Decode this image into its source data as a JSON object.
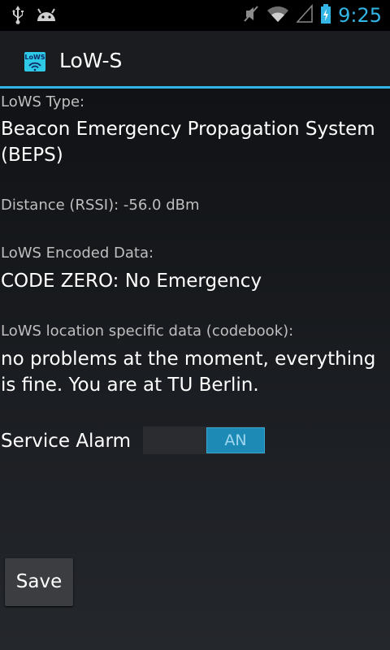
{
  "status_bar": {
    "time": "9:25",
    "icons": [
      "usb-icon",
      "android-debug-icon",
      "mute-icon",
      "wifi-icon",
      "signal-icon",
      "battery-charging-icon"
    ]
  },
  "action_bar": {
    "app_icon_text": "LoWS",
    "title": "LoW-S"
  },
  "fields": {
    "type_label": "LoWS Type:",
    "type_value": "Beacon Emergency Propagation System (BEPS)",
    "distance": "Distance (RSSI): -56.0 dBm",
    "encoded_label": "LoWS Encoded Data:",
    "encoded_value": "CODE ZERO: No Emergency",
    "location_label": "LoWS location specific data (codebook):",
    "location_value": "no problems at the moment, everything is fine. You are at TU Berlin."
  },
  "service_alarm": {
    "label": "Service Alarm",
    "state_text": "AN",
    "on": true
  },
  "buttons": {
    "save": "Save"
  },
  "colors": {
    "accent": "#33b5e5",
    "toggle_on": "#1d8ab5"
  }
}
